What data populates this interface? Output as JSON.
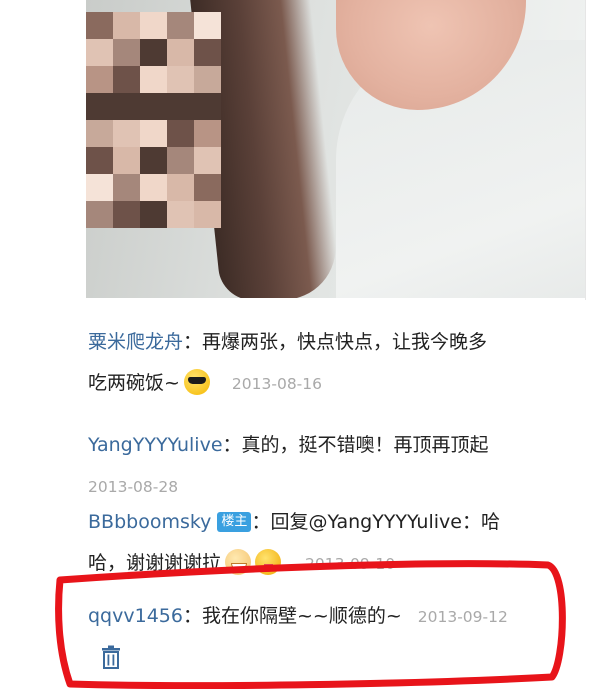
{
  "photo": {
    "description_icon": "photo-image"
  },
  "comments": [
    {
      "user": "粟米爬龙舟",
      "sep": "：",
      "text1": "再爆两张，快点快点，让我今晚多",
      "text2": "吃两碗饭~",
      "emoji": "sunglasses-emoji",
      "date": "2013-08-16"
    },
    {
      "user": "YangYYYYulive",
      "sep": "：",
      "text1": "真的，挺不错噢！再顶再顶起",
      "date": "2013-08-28"
    },
    {
      "user": "BBbboomsky",
      "badge": "楼主",
      "sep": "：",
      "text1": "回复@YangYYYYulive：哈",
      "text2": "哈，谢谢谢谢拉",
      "emojis": [
        "grin-emoji",
        "tongue-emoji"
      ],
      "date": "2013-09-10"
    },
    {
      "user": "qqvv1456",
      "sep": "：",
      "text1": "我在你隔壁~~顺德的~",
      "date": "2013-09-12"
    }
  ],
  "icons": {
    "delete": "trash-icon"
  },
  "colors": {
    "username": "#3b6a9c",
    "date": "#a9a9a9",
    "badge": "#3aa0e0",
    "annotation": "#e8141a"
  }
}
